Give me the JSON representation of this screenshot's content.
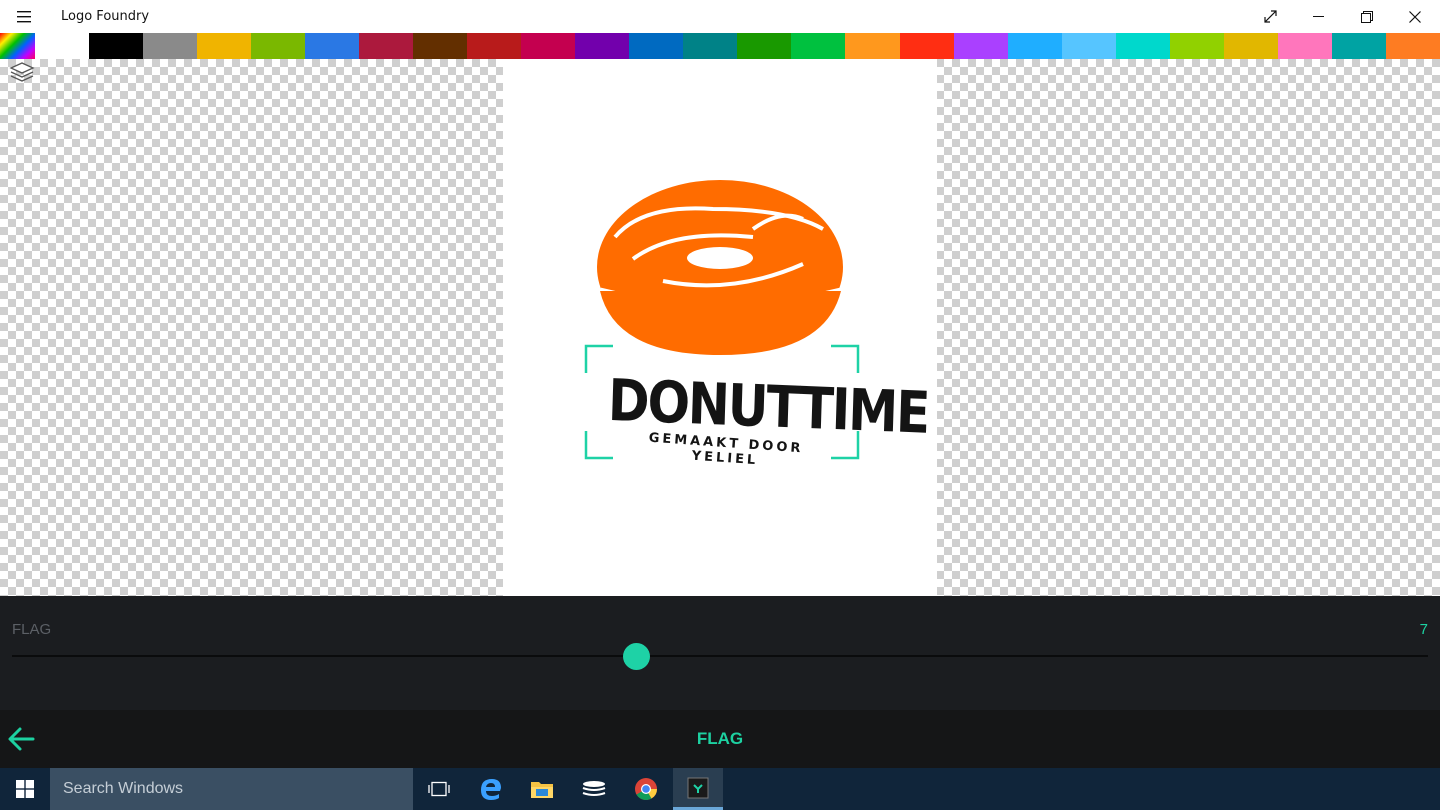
{
  "window": {
    "title": "Logo Foundry"
  },
  "palette": {
    "colors": [
      "#ffffff",
      "#000000",
      "#8a8a8a",
      "#f0b400",
      "#7ab800",
      "#2a78e4",
      "#ac193d",
      "#632f00",
      "#b81b1b",
      "#c4004f",
      "#7200ac",
      "#006ac1",
      "#008287",
      "#199900",
      "#00c13f",
      "#ff981d",
      "#ff2e12",
      "#aa40ff",
      "#1faeff",
      "#56c5ff",
      "#00d8cc",
      "#91d100",
      "#e1b700",
      "#ff76bc",
      "#00a3a3",
      "#fe7c22"
    ]
  },
  "logo": {
    "name": "DONUTTIME",
    "subtitle": "GEMAAKT DOOR YELIEL",
    "donut_color": "#ff6c00",
    "frame_color": "#1ed2a6"
  },
  "slider": {
    "label": "FLAG",
    "value": "7",
    "fraction": 0.441
  },
  "bottom_bar": {
    "title": "FLAG"
  },
  "taskbar": {
    "search_placeholder": "Search Windows"
  }
}
